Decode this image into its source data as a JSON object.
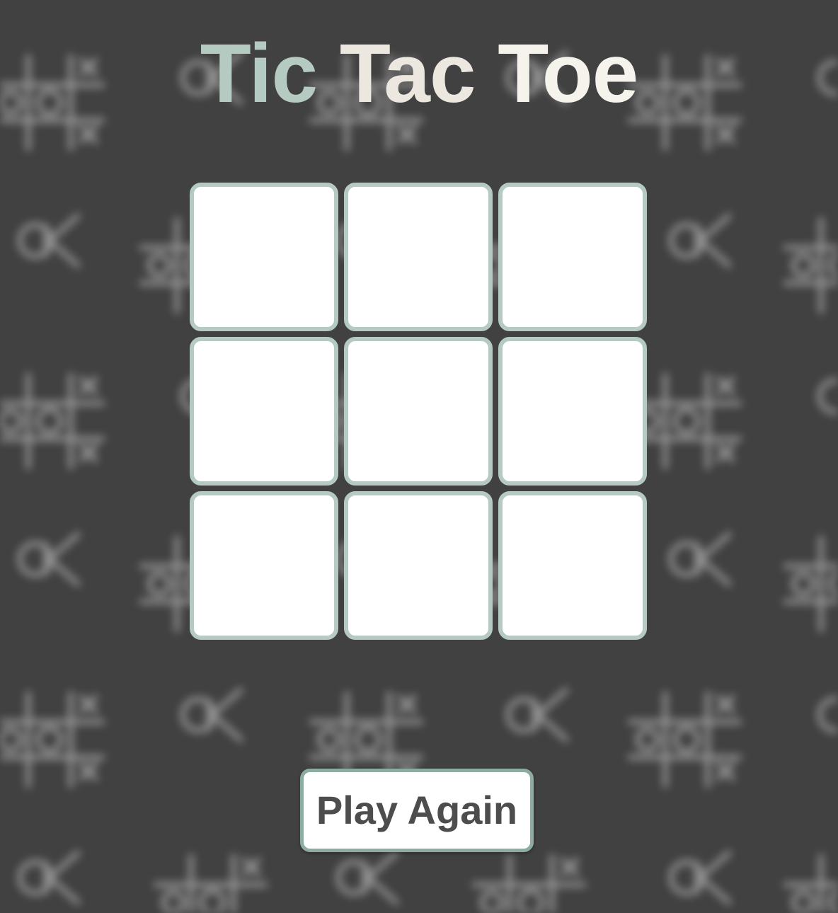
{
  "title": {
    "words": [
      "Tic",
      "Tac",
      "Toe"
    ],
    "colors": [
      "#b5cbc2",
      "#ede8df",
      "#f5f3ec"
    ]
  },
  "board": {
    "cells": [
      "",
      "",
      "",
      "",
      "",
      "",
      "",
      "",
      ""
    ],
    "cell_border_color": "#b5cbc2"
  },
  "controls": {
    "play_again_label": "Play Again"
  },
  "colors": {
    "background": "#414141",
    "pattern": "#d9d9d9"
  }
}
